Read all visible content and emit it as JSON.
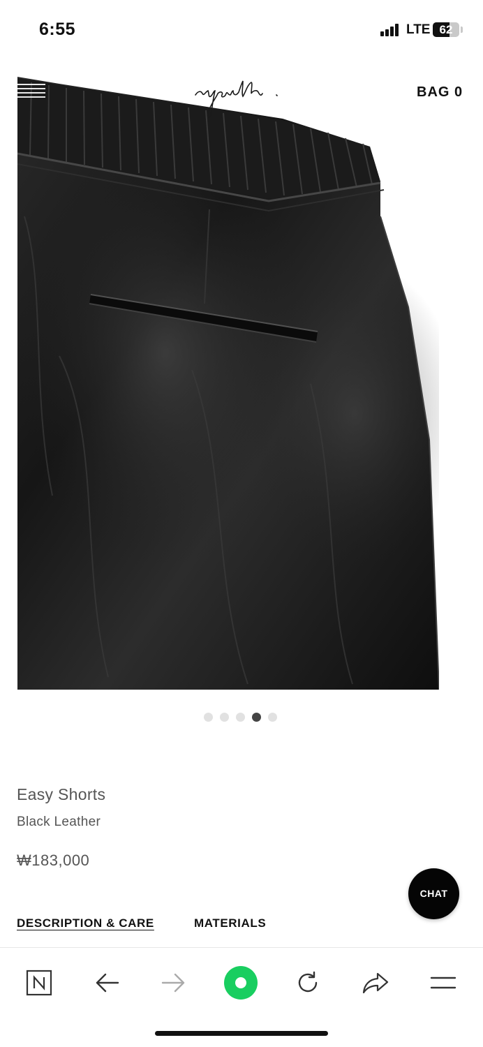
{
  "status_bar": {
    "time": "6:55",
    "network": "LTE",
    "battery": "62",
    "battery_level": 0.62
  },
  "header": {
    "logo_text": "youth.",
    "bag_label": "BAG 0"
  },
  "carousel": {
    "total": 5,
    "active_index": 3
  },
  "product": {
    "name": "Easy Shorts",
    "color": "Black Leather",
    "price": "₩183,000"
  },
  "chat_label": "CHAT",
  "tabs": [
    {
      "label": "DESCRIPTION & CARE",
      "active": true
    },
    {
      "label": "MATERIALS",
      "active": false
    }
  ],
  "browser_toolbar": {
    "icons": [
      "naver-n-icon",
      "back-arrow-icon",
      "forward-arrow-icon",
      "green-home-icon",
      "reload-icon",
      "share-icon",
      "menu-icon"
    ],
    "accent": "#19ce60"
  }
}
